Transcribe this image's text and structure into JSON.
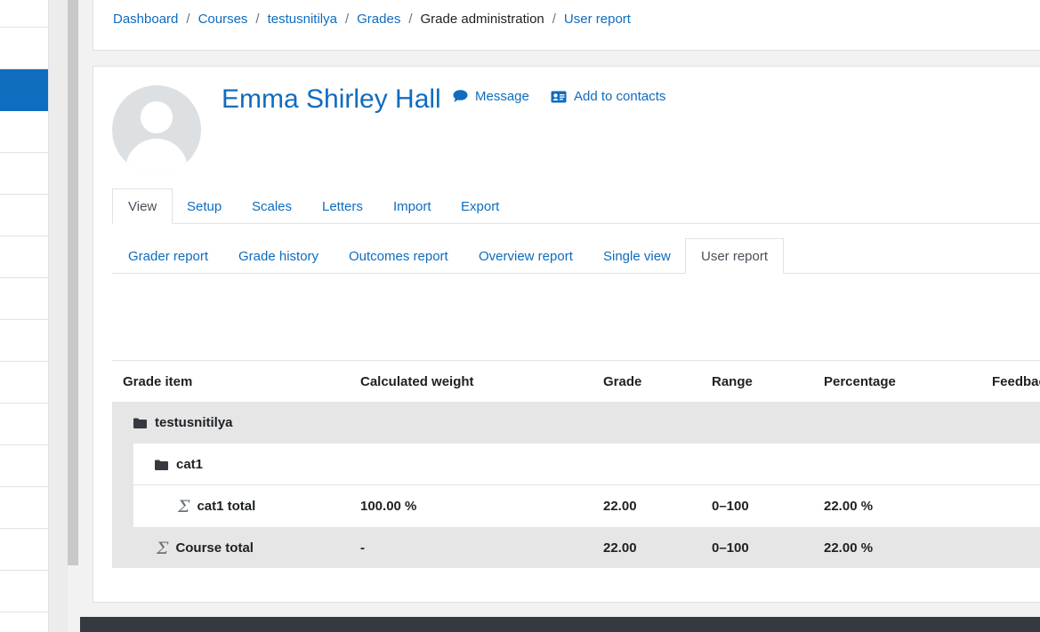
{
  "nav": {
    "active_row": 2,
    "row_count": 15
  },
  "breadcrumb": {
    "items": [
      "Dashboard",
      "Courses",
      "testusnitilya",
      "Grades",
      "Grade administration",
      "User report"
    ],
    "separator": "/"
  },
  "user": {
    "name": "Emma Shirley Hall",
    "message_label": "Message",
    "add_contacts_label": "Add to contacts"
  },
  "tabs_primary": [
    "View",
    "Setup",
    "Scales",
    "Letters",
    "Import",
    "Export"
  ],
  "tabs_secondary": [
    "Grader report",
    "Grade history",
    "Outcomes report",
    "Overview report",
    "Single view",
    "User report"
  ],
  "table": {
    "headers": [
      "Grade item",
      "Calculated weight",
      "Grade",
      "Range",
      "Percentage",
      "Feedback"
    ],
    "category": "testusnitilya",
    "subcategory": "cat1",
    "cat1_total": {
      "item": "cat1 total",
      "weight": "100.00 %",
      "grade": "22.00",
      "range": "0–100",
      "percentage": "22.00 %"
    },
    "course_total": {
      "item": "Course total",
      "weight": "-",
      "grade": "22.00",
      "range": "0–100",
      "percentage": "22.00 %"
    }
  },
  "colors": {
    "link": "#0f6cbf",
    "footer": "#343a40",
    "category_bg": "#e6e6e6"
  }
}
